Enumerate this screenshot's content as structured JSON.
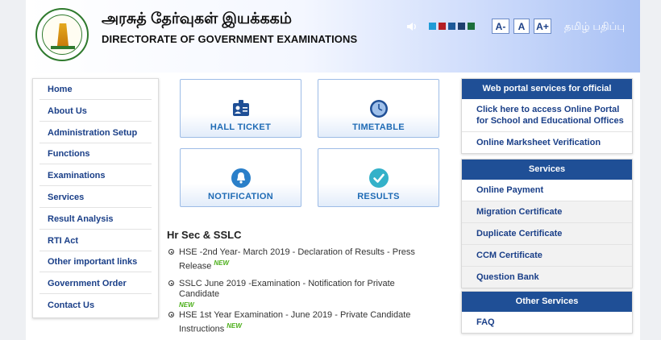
{
  "header": {
    "title_tamil": "அரசுத் தேர்வுகள் இயக்ககம்",
    "title_english": "DIRECTORATE OF GOVERNMENT EXAMINATIONS",
    "speaker_icon": "speaker-icon",
    "theme_colors": [
      "#1f9bd6",
      "#b51f24",
      "#1d5a9a",
      "#1e3f6e",
      "#1b6e3a"
    ],
    "font_decrease": "A-",
    "font_normal": "A",
    "font_increase": "A+",
    "language_toggle": "தமிழ் பதிப்பு"
  },
  "left_menu": {
    "items": [
      {
        "label": "Home"
      },
      {
        "label": "About Us"
      },
      {
        "label": "Administration Setup"
      },
      {
        "label": "Functions"
      },
      {
        "label": "Examinations"
      },
      {
        "label": "Services"
      },
      {
        "label": "Result Analysis"
      },
      {
        "label": "RTI Act"
      },
      {
        "label": "Other important links"
      },
      {
        "label": "Government Order"
      },
      {
        "label": "Contact Us"
      }
    ]
  },
  "tiles": [
    {
      "label": "HALL TICKET",
      "icon": "id-card-icon"
    },
    {
      "label": "TIMETABLE",
      "icon": "clock-icon"
    },
    {
      "label": "NOTIFICATION",
      "icon": "bell-icon"
    },
    {
      "label": "RESULTS",
      "icon": "check-icon"
    }
  ],
  "news": {
    "title": "Hr Sec & SSLC",
    "new_badge": "NEW",
    "items": [
      {
        "text": "HSE -2nd Year- March 2019 - Declaration of Results - Press Release"
      },
      {
        "text": "SSLC June 2019 -Examination - Notification for Private Candidate"
      },
      {
        "text": "HSE 1st Year Examination - June 2019 - Private Candidate Instructions"
      }
    ]
  },
  "panels": {
    "official": {
      "title": "Web portal services for official",
      "items": [
        {
          "label": "Click here to access Online Portal for School and Educational Offices"
        },
        {
          "label": "Online Marksheet Verification"
        }
      ]
    },
    "services": {
      "title": "Services",
      "items": [
        {
          "label": "Online Payment"
        },
        {
          "label": "Migration Certificate"
        },
        {
          "label": "Duplicate Certificate"
        },
        {
          "label": "CCM Certificate"
        },
        {
          "label": "Question Bank"
        }
      ]
    },
    "other": {
      "title": "Other Services",
      "items": [
        {
          "label": "FAQ"
        }
      ]
    }
  }
}
